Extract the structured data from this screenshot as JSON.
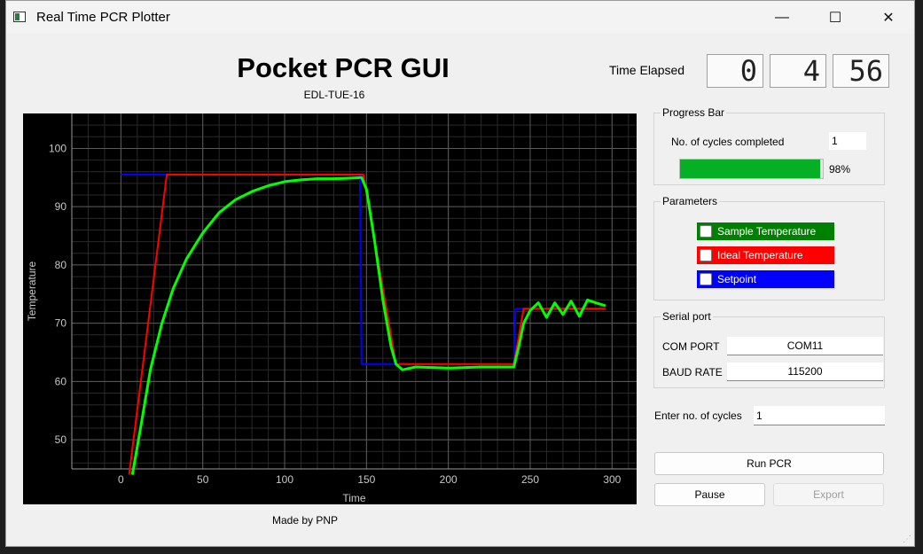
{
  "window": {
    "title": "Real Time PCR Plotter",
    "min": "—",
    "max": "☐",
    "close": "✕"
  },
  "header": {
    "title": "Pocket PCR GUI",
    "subtitle": "EDL-TUE-16"
  },
  "timer": {
    "label": "Time Elapsed",
    "digits": [
      "0",
      "4",
      "56"
    ]
  },
  "footer": {
    "credit": "Made by PNP"
  },
  "progress": {
    "group_title": "Progress Bar",
    "cycles_label": "No. of cycles completed",
    "cycles_value": "1",
    "percent": 98,
    "percent_text": "98%",
    "fill_color": "#06b025"
  },
  "parameters": {
    "group_title": "Parameters",
    "items": [
      {
        "label": "Sample Temperature",
        "color": "#008000",
        "checked": false
      },
      {
        "label": "Ideal Temperature",
        "color": "#ff0000",
        "checked": false
      },
      {
        "label": "Setpoint",
        "color": "#0000ff",
        "checked": false
      }
    ]
  },
  "serial": {
    "group_title": "Serial port",
    "com_label": "COM PORT",
    "com_value": "COM11",
    "baud_label": "BAUD RATE",
    "baud_value": "115200"
  },
  "cycles_input": {
    "label": "Enter no. of cycles",
    "value": "1"
  },
  "buttons": {
    "run": "Run PCR",
    "pause": "Pause",
    "export": "Export"
  },
  "chart_data": {
    "type": "line",
    "xlabel": "Time",
    "ylabel": "Temperature",
    "xlim": [
      -30,
      315
    ],
    "ylim": [
      45,
      106
    ],
    "xticks": [
      0,
      50,
      100,
      150,
      200,
      250,
      300
    ],
    "yticks": [
      50,
      60,
      70,
      80,
      90,
      100
    ],
    "grid": true,
    "background": "#000000",
    "series": [
      {
        "color": "#0000ff",
        "x": [
          0,
          28,
          146,
          147,
          166,
          240,
          241,
          296
        ],
        "y": [
          95.5,
          95.5,
          95.5,
          63,
          63,
          63,
          72.5,
          72.5
        ]
      },
      {
        "color": "#ff0000",
        "x": [
          5,
          28,
          148,
          168,
          240,
          246,
          296
        ],
        "y": [
          44,
          95.5,
          95.5,
          63,
          63,
          72.5,
          72.5
        ]
      },
      {
        "color": "#00ff00",
        "x": [
          7,
          12,
          18,
          25,
          32,
          40,
          50,
          60,
          70,
          80,
          90,
          100,
          110,
          120,
          130,
          140,
          147,
          150,
          155,
          160,
          165,
          168,
          172,
          180,
          200,
          220,
          240,
          243,
          246,
          250,
          255,
          260,
          265,
          270,
          275,
          280,
          285,
          290,
          296
        ],
        "y": [
          44,
          52,
          62,
          70,
          76,
          81,
          85.5,
          89,
          91.2,
          92.6,
          93.6,
          94.3,
          94.6,
          94.8,
          94.8,
          94.9,
          95,
          93,
          84,
          74,
          66,
          63,
          62,
          62.5,
          62.3,
          62.5,
          62.5,
          66,
          70,
          72.2,
          73.5,
          71,
          73.5,
          71.5,
          73.8,
          71.2,
          74,
          73.5,
          73
        ]
      }
    ]
  }
}
